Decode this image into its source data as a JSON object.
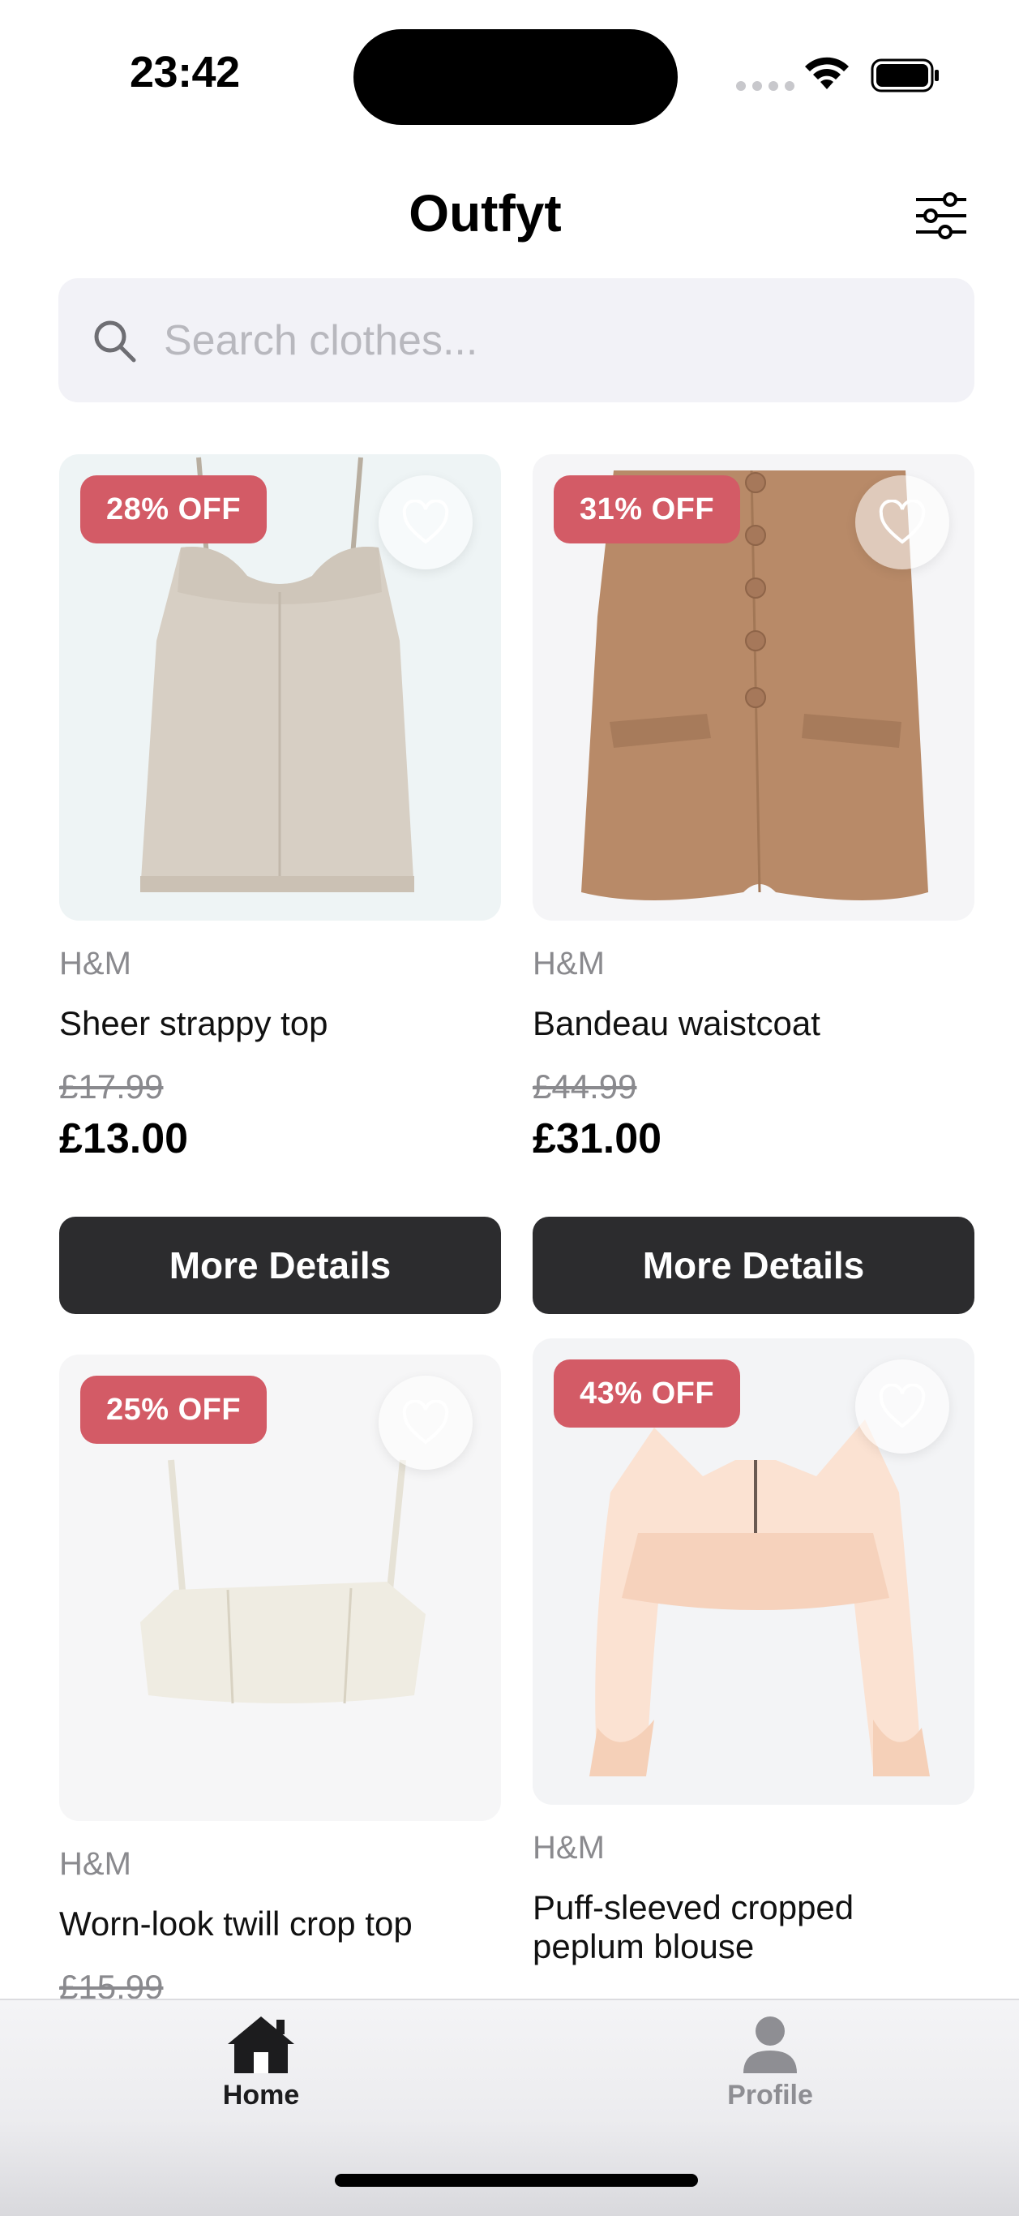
{
  "status": {
    "time": "23:42"
  },
  "header": {
    "title": "Outfyt",
    "filter_icon": "sliders-icon"
  },
  "search": {
    "placeholder": "Search clothes...",
    "value": ""
  },
  "products": [
    {
      "discount": "28% OFF",
      "brand": "H&M",
      "name": "Sheer strappy top",
      "old_price": "£17.99",
      "price": "£13.00",
      "button": "More Details"
    },
    {
      "discount": "31% OFF",
      "brand": "H&M",
      "name": "Bandeau waistcoat",
      "old_price": "£44.99",
      "price": "£31.00",
      "button": "More Details"
    },
    {
      "discount": "25% OFF",
      "brand": "H&M",
      "name": "Worn-look twill crop top",
      "old_price": "£15.99",
      "price": "",
      "button": ""
    },
    {
      "discount": "43% OFF",
      "brand": "H&M",
      "name": "Puff-sleeved cropped peplum blouse",
      "old_price": "",
      "price": "",
      "button": ""
    }
  ],
  "tabs": [
    {
      "label": "Home",
      "icon": "home-icon",
      "active": true
    },
    {
      "label": "Profile",
      "icon": "person-icon",
      "active": false
    }
  ],
  "colors": {
    "badge": "#d35b66",
    "button": "#2c2c2e",
    "search_bg": "#f2f2f7",
    "muted": "#8a8a8e"
  }
}
